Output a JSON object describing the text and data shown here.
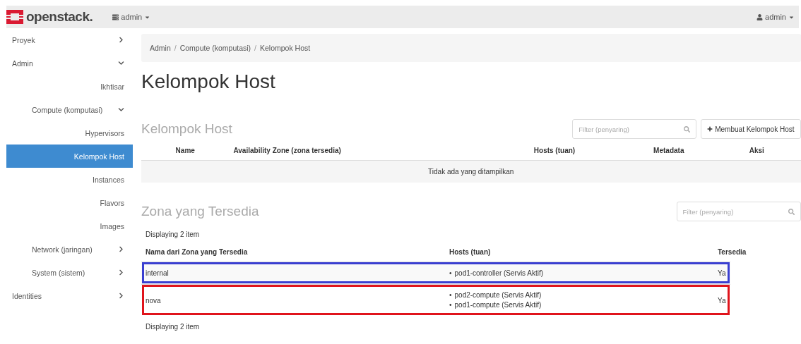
{
  "topbar": {
    "logo": "openstack.",
    "project_menu": "admin",
    "user_menu": "admin"
  },
  "sidebar": {
    "items": [
      {
        "label": "Proyek",
        "expanded": false,
        "selected": false
      },
      {
        "label": "Admin",
        "expanded": true,
        "selected": false,
        "children": [
          {
            "label": "Ikhtisar",
            "selected": false
          },
          {
            "label": "Compute (komputasi)",
            "expanded": true,
            "selected": false,
            "children": [
              {
                "label": "Hypervisors",
                "selected": false
              },
              {
                "label": "Kelompok Host",
                "selected": true
              },
              {
                "label": "Instances",
                "selected": false
              },
              {
                "label": "Flavors",
                "selected": false
              },
              {
                "label": "Images",
                "selected": false
              }
            ]
          },
          {
            "label": "Network (jaringan)",
            "expanded": false,
            "selected": false
          },
          {
            "label": "System (sistem)",
            "expanded": false,
            "selected": false
          }
        ]
      },
      {
        "label": "Identities",
        "expanded": false,
        "selected": false
      }
    ]
  },
  "breadcrumb": [
    "Admin",
    "Compute (komputasi)",
    "Kelompok Host"
  ],
  "breadcrumb_separator": "/",
  "page_title": "Kelompok Host",
  "host_aggregates": {
    "title": "Kelompok Host",
    "filter": {
      "placeholder": "Filter (penyaring)"
    },
    "create_button": "Membuat Kelompok Host",
    "columns": [
      "Name",
      "Availability Zone (zona tersedia)",
      "Hosts (tuan)",
      "Metadata",
      "Aksi"
    ],
    "empty_message": "Tidak ada yang ditampilkan"
  },
  "availability_zones": {
    "title": "Zona yang Tersedia",
    "filter": {
      "placeholder": "Filter (penyaring)"
    },
    "count_top": "Displaying 2 item",
    "host_bullet": "•",
    "columns": [
      "Nama dari Zona yang Tersedia",
      "Hosts (tuan)",
      "Tersedia"
    ],
    "rows": [
      {
        "name": "internal",
        "hosts": [
          "pod1-controller (Servis Aktif)"
        ],
        "available": "Ya",
        "color": "#3a3fd0"
      },
      {
        "name": "nova",
        "hosts": [
          "pod2-compute (Servis Aktif)",
          "pod1-compute (Servis Aktif)"
        ],
        "available": "Ya",
        "color": "#e0141c"
      }
    ],
    "count_bottom": "Displaying 2 item"
  }
}
